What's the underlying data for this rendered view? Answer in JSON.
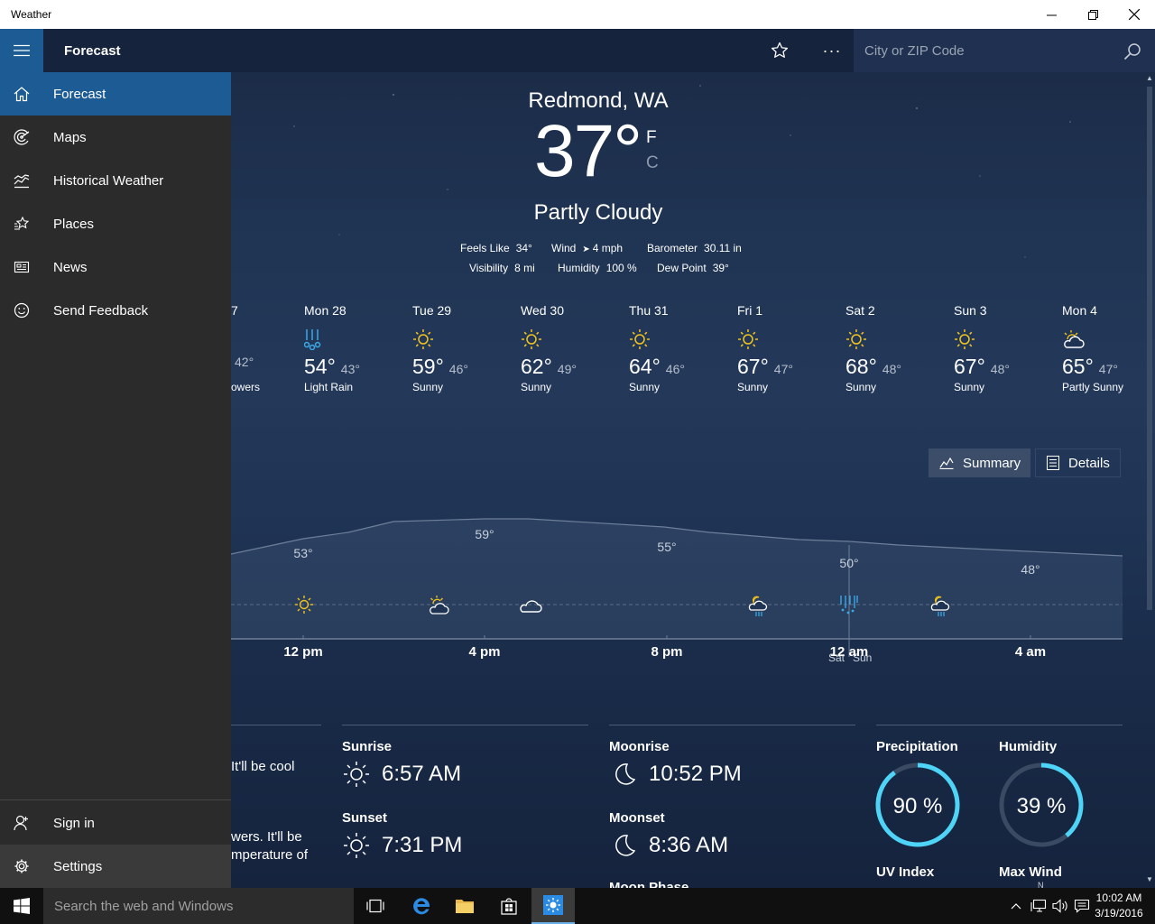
{
  "window": {
    "title": "Weather"
  },
  "appbar": {
    "title": "Forecast",
    "search_placeholder": "City or ZIP Code",
    "more_label": "···"
  },
  "nav": {
    "items": [
      {
        "label": "Forecast",
        "icon": "home-icon"
      },
      {
        "label": "Maps",
        "icon": "radar-icon"
      },
      {
        "label": "Historical Weather",
        "icon": "chart-icon"
      },
      {
        "label": "Places",
        "icon": "star-list-icon"
      },
      {
        "label": "News",
        "icon": "news-icon"
      },
      {
        "label": "Send Feedback",
        "icon": "smiley-icon"
      }
    ],
    "bottom_items": [
      {
        "label": "Sign in",
        "icon": "person-icon"
      },
      {
        "label": "Settings",
        "icon": "gear-icon"
      }
    ]
  },
  "current": {
    "city": "Redmond, WA",
    "temp": "37°",
    "unit_f": "F",
    "unit_c": "C",
    "condition": "Partly Cloudy",
    "feels_like_label": "Feels Like",
    "feels_like": "34°",
    "wind_label": "Wind",
    "wind": "4 mph",
    "barometer_label": "Barometer",
    "barometer": "30.11 in",
    "visibility_label": "Visibility",
    "visibility": "8 mi",
    "humidity_label": "Humidity",
    "humidity": "100 %",
    "dewpoint_label": "Dew Point",
    "dewpoint": "39°"
  },
  "daily": [
    {
      "day": "7",
      "hi": "",
      "lo": "42°",
      "cond": "owers",
      "icon": "none"
    },
    {
      "day": "Mon 28",
      "hi": "54°",
      "lo": "43°",
      "cond": "Light Rain",
      "icon": "rain-icon"
    },
    {
      "day": "Tue 29",
      "hi": "59°",
      "lo": "46°",
      "cond": "Sunny",
      "icon": "sun-icon"
    },
    {
      "day": "Wed 30",
      "hi": "62°",
      "lo": "49°",
      "cond": "Sunny",
      "icon": "sun-icon"
    },
    {
      "day": "Thu 31",
      "hi": "64°",
      "lo": "46°",
      "cond": "Sunny",
      "icon": "sun-icon"
    },
    {
      "day": "Fri 1",
      "hi": "67°",
      "lo": "47°",
      "cond": "Sunny",
      "icon": "sun-icon"
    },
    {
      "day": "Sat 2",
      "hi": "68°",
      "lo": "48°",
      "cond": "Sunny",
      "icon": "sun-icon"
    },
    {
      "day": "Sun 3",
      "hi": "67°",
      "lo": "48°",
      "cond": "Sunny",
      "icon": "sun-icon"
    },
    {
      "day": "Mon 4",
      "hi": "65°",
      "lo": "47°",
      "cond": "Partly Sunny",
      "icon": "partly-sunny-icon"
    }
  ],
  "toggles": {
    "summary": "Summary",
    "details": "Details"
  },
  "hourly": {
    "temp_labels": [
      "53°",
      "59°",
      "55°",
      "50°",
      "48°"
    ],
    "time_labels": [
      "12 pm",
      "4 pm",
      "8 pm",
      "12 am",
      "4 am"
    ],
    "day_change": {
      "before": "Sat",
      "after": "Sun"
    },
    "icons": [
      "sun-icon",
      "partly-sunny-icon",
      "cloud-icon",
      "night-rain-icon",
      "heavy-rain-icon",
      "night-rain-icon"
    ]
  },
  "details": {
    "partial_1": "It'll be cool",
    "partial_2": "wers. It'll be",
    "partial_3": "mperature of",
    "sunrise_label": "Sunrise",
    "sunrise": "6:57 AM",
    "sunset_label": "Sunset",
    "sunset": "7:31 PM",
    "moonrise_label": "Moonrise",
    "moonrise": "10:52 PM",
    "moonset_label": "Moonset",
    "moonset": "8:36 AM",
    "moonphase_label": "Moon Phase",
    "precipitation_label": "Precipitation",
    "precipitation": "90 %",
    "precipitation_value": 0.9,
    "humidity_label": "Humidity",
    "humidity": "39 %",
    "humidity_value": 0.39,
    "uv_label": "UV Index",
    "maxwind_label": "Max Wind",
    "maxwind_dir": "N"
  },
  "taskbar": {
    "search_placeholder": "Search the web and Windows",
    "time": "10:02 AM",
    "date": "3/19/2016"
  },
  "colors": {
    "accent": "#1d5b94",
    "sun": "#f3c41c",
    "rain": "#3aa9e8",
    "ring": "#4dd4f7",
    "sidebar": "#2b2b2b"
  }
}
